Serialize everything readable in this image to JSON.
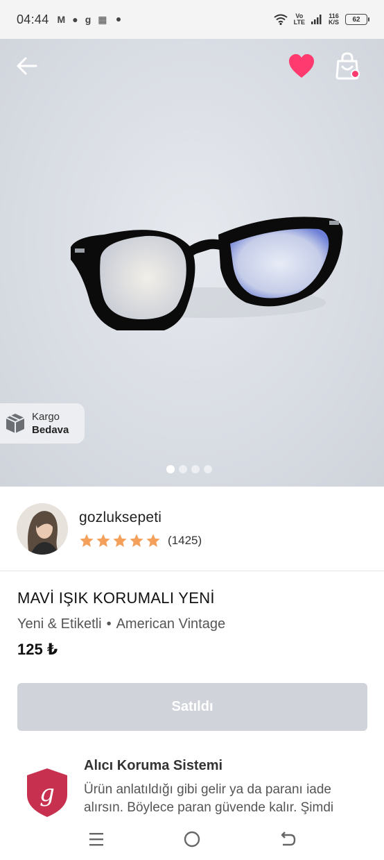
{
  "status_bar": {
    "time": "04:44",
    "network_top": "Vo",
    "network_bottom": "LTE",
    "speed_top": "116",
    "speed_bottom": "K/S",
    "battery": "62"
  },
  "product_gallery": {
    "shipping_badge_line1": "Kargo",
    "shipping_badge_line2": "Bedava",
    "image_count": 4,
    "active_image": 1,
    "heart_color": "#ff3a6e"
  },
  "seller": {
    "name": "gozluksepeti",
    "rating_stars": 5,
    "rating_count": "(1425)",
    "star_color": "#f5a05a"
  },
  "product": {
    "title": "MAVİ IŞIK KORUMALI YENİ",
    "condition": "Yeni & Etiketli",
    "separator": "•",
    "brand": "American Vintage",
    "price": "125 ₺",
    "sold_label": "Satıldı"
  },
  "protection": {
    "title": "Alıcı Koruma Sistemi",
    "text": "Ürün anlatıldığı gibi gelir ya da paranı iade alırsın. Böylece paran güvende kalır. Şimdi",
    "logo_letter": "g",
    "logo_color": "#c8304f"
  },
  "nav_bar": {
    "icons": [
      "menu-icon",
      "home-icon",
      "back-icon"
    ]
  }
}
